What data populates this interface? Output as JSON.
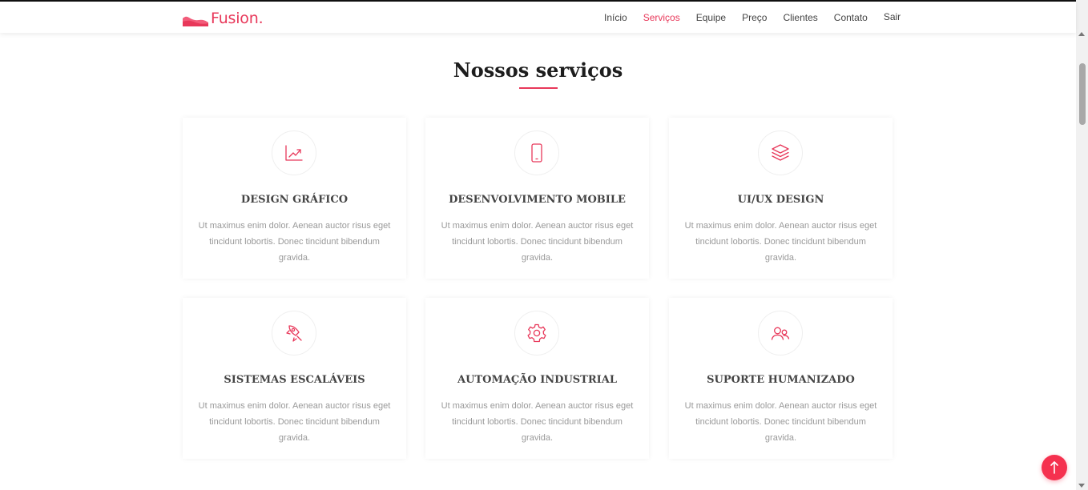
{
  "brand": {
    "name": "Fusion.",
    "accent": "#e8385a"
  },
  "nav": {
    "items": [
      {
        "label": "Início",
        "active": false
      },
      {
        "label": "Serviços",
        "active": true
      },
      {
        "label": "Equipe",
        "active": false
      },
      {
        "label": "Preço",
        "active": false
      },
      {
        "label": "Clientes",
        "active": false
      },
      {
        "label": "Contato",
        "active": false
      }
    ],
    "logout": "Sair"
  },
  "section": {
    "title": "Nossos serviços"
  },
  "services": [
    {
      "icon": "chart-line-icon",
      "title": "DESIGN GRÁFICO",
      "text": "Ut maximus enim dolor. Aenean auctor risus eget tincidunt lobortis. Donec tincidunt bibendum gravida."
    },
    {
      "icon": "mobile-phone-icon",
      "title": "DESENVOLVIMENTO MOBILE",
      "text": "Ut maximus enim dolor. Aenean auctor risus eget tincidunt lobortis. Donec tincidunt bibendum gravida."
    },
    {
      "icon": "layers-icon",
      "title": "UI/UX DESIGN",
      "text": "Ut maximus enim dolor. Aenean auctor risus eget tincidunt lobortis. Donec tincidunt bibendum gravida."
    },
    {
      "icon": "rocket-icon",
      "title": "SISTEMAS ESCALÁVEIS",
      "text": "Ut maximus enim dolor. Aenean auctor risus eget tincidunt lobortis. Donec tincidunt bibendum gravida."
    },
    {
      "icon": "gear-icon",
      "title": "AUTOMAÇÃO INDUSTRIAL",
      "text": "Ut maximus enim dolor. Aenean auctor risus eget tincidunt lobortis. Donec tincidunt bibendum gravida."
    },
    {
      "icon": "users-icon",
      "title": "SUPORTE HUMANIZADO",
      "text": "Ut maximus enim dolor. Aenean auctor risus eget tincidunt lobortis. Donec tincidunt bibendum gravida."
    }
  ],
  "back_to_top": {
    "icon": "arrow-up-icon",
    "color": "#f5314f"
  }
}
